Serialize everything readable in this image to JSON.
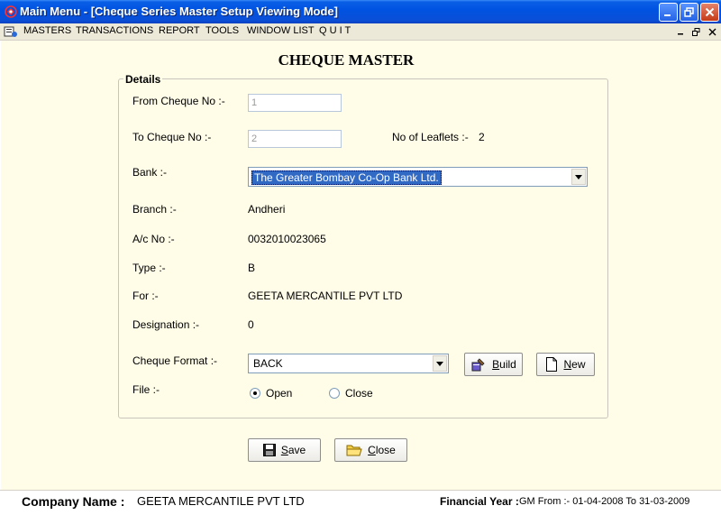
{
  "window": {
    "title": "Main Menu - [Cheque Series Master Setup Viewing Mode]"
  },
  "menu": {
    "items": [
      "MASTERS",
      "TRANSACTIONS",
      "REPORT",
      "TOOLS",
      "WINDOW LIST",
      "Q U I T"
    ]
  },
  "form": {
    "title": "CHEQUE MASTER",
    "group_label": "Details",
    "from_cheque": {
      "label": "From Cheque No :-",
      "value": "1"
    },
    "to_cheque": {
      "label": "To Cheque No :-",
      "value": "2"
    },
    "leaflets": {
      "label": "No of Leaflets :-",
      "value": "2"
    },
    "bank": {
      "label": "Bank :-",
      "value": "The Greater Bombay Co-Op Bank Ltd."
    },
    "branch": {
      "label": "Branch :-",
      "value": "Andheri"
    },
    "ac_no": {
      "label": "A/c No :-",
      "value": "0032010023065"
    },
    "type": {
      "label": "Type :-",
      "value": "B"
    },
    "for": {
      "label": "For :-",
      "value": "GEETA MERCANTILE PVT LTD"
    },
    "designation": {
      "label": "Designation :-",
      "value": "0"
    },
    "cheque_format": {
      "label": "Cheque Format :-",
      "value": "BACK"
    },
    "build_button": {
      "prefix": "",
      "underlined": "B",
      "rest": "uild"
    },
    "new_button": {
      "underlined": "N",
      "rest": "ew"
    },
    "file": {
      "label": "File :-",
      "options": [
        "Open",
        "Close"
      ],
      "selected": "Open"
    },
    "save_button": {
      "underlined": "S",
      "rest": "ave"
    },
    "close_button": {
      "underlined": "C",
      "rest": "lose"
    }
  },
  "status": {
    "company_label": "Company Name :",
    "company_value": "GEETA MERCANTILE PVT LTD",
    "fy_label": "Financial Year :",
    "fy_value": "GM From :- 01-04-2008 To 31-03-2009"
  },
  "colors": {
    "titlebar": "#0053e1",
    "form_bg": "#fffde8",
    "selection": "#316ac5"
  }
}
